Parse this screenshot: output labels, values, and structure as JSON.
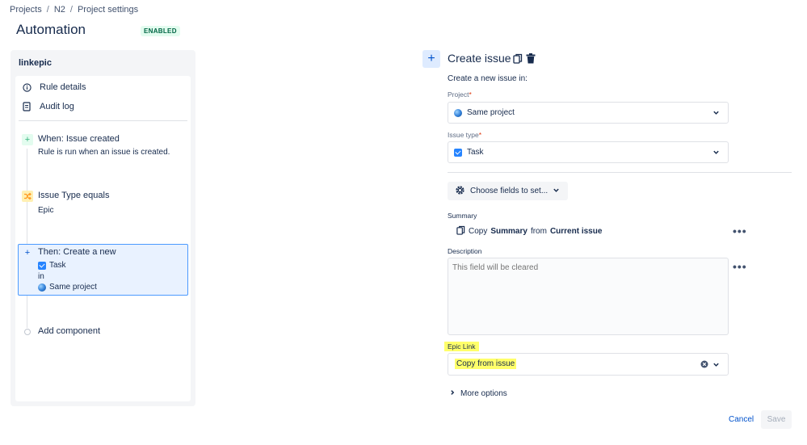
{
  "breadcrumb": [
    "Projects",
    "N2",
    "Project settings"
  ],
  "page": {
    "title": "Automation",
    "status_badge": "ENABLED"
  },
  "rule": {
    "name": "linkepic",
    "nav": {
      "rule_details": "Rule details",
      "audit_log": "Audit log"
    },
    "components": [
      {
        "title": "When: Issue created",
        "subtitle": "Rule is run when an issue is created."
      },
      {
        "title": "Issue Type equals",
        "subtitle": "Epic"
      },
      {
        "title": "Then: Create a new",
        "issue_type": "Task",
        "joiner": "in",
        "project": "Same project"
      }
    ],
    "add_component": "Add component"
  },
  "action": {
    "title": "Create issue",
    "description": "Create a new issue in:",
    "project_label": "Project",
    "project_value": "Same project",
    "issue_type_label": "Issue type",
    "issue_type_value": "Task",
    "required_marker": "*",
    "choose_fields_label": "Choose fields to set...",
    "summary_label": "Summary",
    "summary_copy": "Copy",
    "summary_field": "Summary",
    "summary_from": "from",
    "summary_source": "Current issue",
    "description_label": "Description",
    "description_placeholder": "This field will be cleared",
    "epic_link_label": "Epic Link",
    "epic_link_value": "Copy from issue",
    "more_options": "More options"
  },
  "footer": {
    "cancel": "Cancel",
    "save": "Save"
  },
  "colors": {
    "accent": "#0052cc",
    "highlight": "#ffff6a",
    "selected_bg": "#e9f2ff",
    "badge_green": "#006644"
  }
}
